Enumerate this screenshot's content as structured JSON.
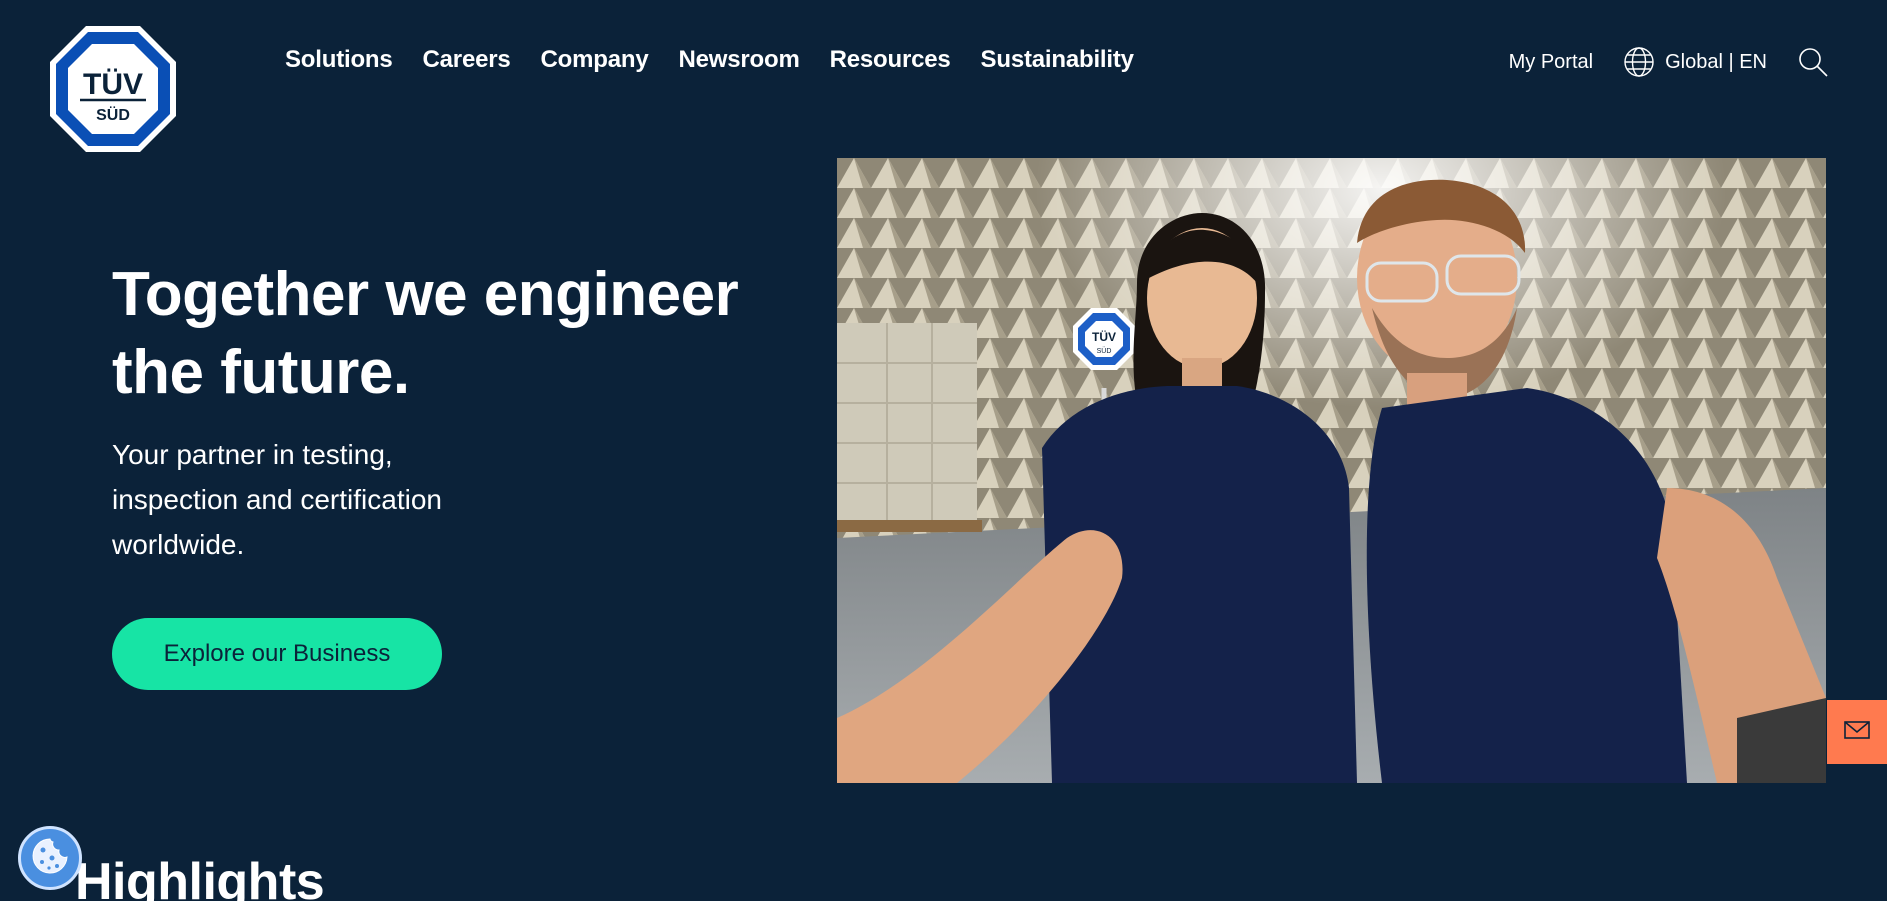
{
  "brand": {
    "logo_text_top": "TÜV",
    "logo_text_bottom": "SÜD",
    "primary_blue": "#0a4fb5",
    "navy": "#0b2239"
  },
  "nav": {
    "items": [
      {
        "label": "Solutions"
      },
      {
        "label": "Careers"
      },
      {
        "label": "Company"
      },
      {
        "label": "Newsroom"
      },
      {
        "label": "Resources"
      },
      {
        "label": "Sustainability"
      }
    ]
  },
  "utility": {
    "portal_label": "My Portal",
    "locale_label": "Global | EN",
    "locale_icon": "globe-icon",
    "search_icon": "search-icon"
  },
  "hero": {
    "title": "Together we engineer the future.",
    "subtitle": "Your partner in testing, inspection and certification worldwide.",
    "cta_label": "Explore our Business",
    "cta_color": "#17e4a5",
    "image_sign_top": "TÜV",
    "image_sign_bottom": "SÜD"
  },
  "feedback": {
    "icon": "mail-icon",
    "color": "#ff7a4f"
  },
  "highlights": {
    "title": "Highlights"
  },
  "cookie": {
    "icon": "cookie-icon"
  }
}
